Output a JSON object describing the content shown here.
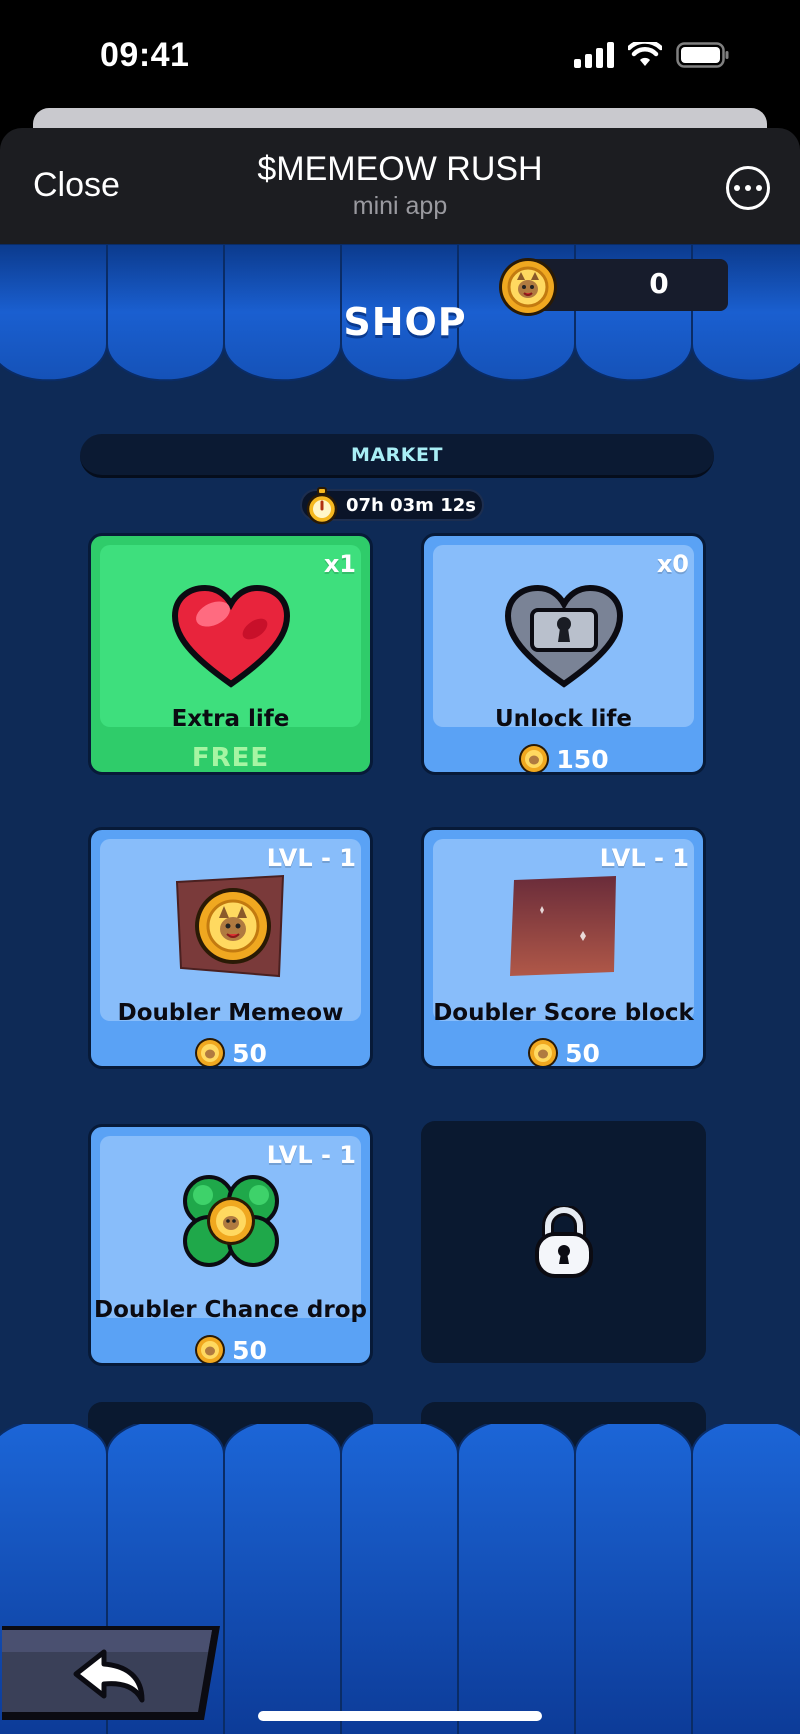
{
  "status": {
    "time": "09:41"
  },
  "header": {
    "close_label": "Close",
    "title": "$MEMEOW RUSH",
    "subtitle": "mini app"
  },
  "shop": {
    "title": "SHOP",
    "coins": "0",
    "market_label": "MARKET",
    "timer": "07h 03m 12s",
    "cards": [
      {
        "name": "Extra life",
        "badge": "x1",
        "price": "FREE",
        "icon": "heart-icon"
      },
      {
        "name": "Unlock life",
        "badge": "x0",
        "price": "150",
        "icon": "locked-heart-icon"
      },
      {
        "name": "Doubler Memeow",
        "badge": "LVL - 1",
        "price": "50",
        "icon": "memeow-block-icon"
      },
      {
        "name": "Doubler Score block",
        "badge": "LVL - 1",
        "price": "50",
        "icon": "score-block-icon"
      },
      {
        "name": "Doubler Chance drop",
        "badge": "LVL - 1",
        "price": "50",
        "icon": "clover-icon"
      }
    ]
  },
  "colors": {
    "background": "#0e2a56",
    "card_blue": "#5aa2f5",
    "card_green": "#2fcc6a",
    "awning": "#1a5fd0"
  }
}
